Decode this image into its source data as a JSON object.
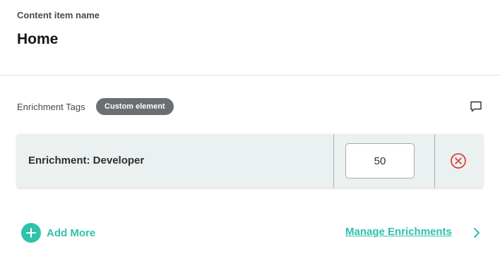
{
  "header": {
    "item_name_label": "Content item name",
    "title": "Home"
  },
  "tags": {
    "label": "Enrichment Tags",
    "badge": "Custom element",
    "comment_icon": "comment-icon"
  },
  "enrichments": [
    {
      "label": "Enrichment: Developer",
      "value": "50",
      "remove_icon": "close-circle-icon"
    }
  ],
  "actions": {
    "add_more": "Add More",
    "manage": "Manage Enrichments"
  },
  "colors": {
    "accent": "#2fc1ab",
    "remove": "#d9443a",
    "badge_bg": "#6b6f73",
    "row_bg": "#ebf0f0"
  }
}
